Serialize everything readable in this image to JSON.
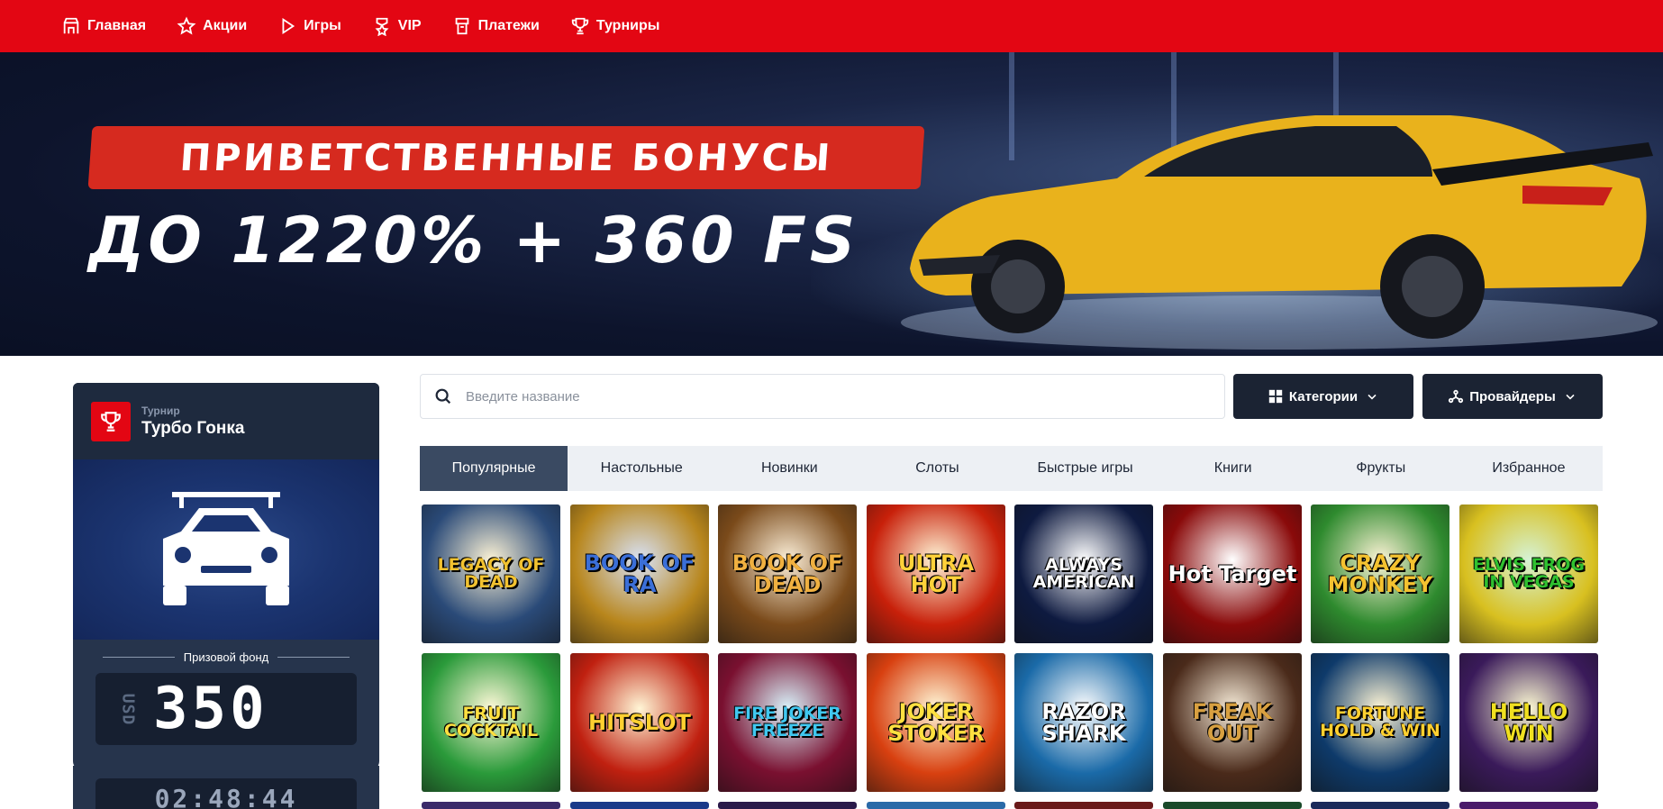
{
  "nav": {
    "items": [
      {
        "label": "Главная",
        "icon": "home-icon"
      },
      {
        "label": "Акции",
        "icon": "star-icon"
      },
      {
        "label": "Игры",
        "icon": "play-icon"
      },
      {
        "label": "VIP",
        "icon": "vip-icon"
      },
      {
        "label": "Платежи",
        "icon": "wallet-icon"
      },
      {
        "label": "Турниры",
        "icon": "trophy-icon"
      }
    ]
  },
  "banner": {
    "label": "ПРИВЕТСТВЕННЫЕ БОНУСЫ",
    "headline": "ДО 1220% + 360 FS"
  },
  "tournament": {
    "kicker": "Турнир",
    "name": "Турбо Гонка",
    "prize_label": "Призовой фонд",
    "currency": "USD",
    "amount": "350",
    "timer": "02:48:44"
  },
  "search": {
    "placeholder": "Введите название"
  },
  "filters": {
    "categories_label": "Категории",
    "providers_label": "Провайдеры"
  },
  "tabs": [
    {
      "label": "Популярные",
      "active": true
    },
    {
      "label": "Настольные",
      "active": false
    },
    {
      "label": "Новинки",
      "active": false
    },
    {
      "label": "Слоты",
      "active": false
    },
    {
      "label": "Быстрые игры",
      "active": false
    },
    {
      "label": "Книги",
      "active": false
    },
    {
      "label": "Фрукты",
      "active": false
    },
    {
      "label": "Избранное",
      "active": false
    }
  ],
  "games": [
    {
      "title": "LEGACY OF DEAD",
      "bg": "#2a4a78",
      "fg": "#f2c230"
    },
    {
      "title": "BOOK OF RA",
      "bg": "#b8861c",
      "fg": "#3b6fd8"
    },
    {
      "title": "BOOK OF DEAD",
      "bg": "#7a4a1a",
      "fg": "#f0b040"
    },
    {
      "title": "ULTRA HOT",
      "bg": "#c8200a",
      "fg": "#ffd23a"
    },
    {
      "title": "ALWAYS AMERICAN",
      "bg": "#0e1a40",
      "fg": "#ffffff"
    },
    {
      "title": "Hot Target",
      "bg": "#8a0a0a",
      "fg": "#ffffff"
    },
    {
      "title": "CRAZY MONKEY",
      "bg": "#2e8a2e",
      "fg": "#f4c230"
    },
    {
      "title": "ELVIS FROG IN VEGAS",
      "bg": "#d8c020",
      "fg": "#30c030"
    },
    {
      "title": "FRUIT COCKTAIL",
      "bg": "#2a9a3a",
      "fg": "#ffe040"
    },
    {
      "title": "HITSLOT",
      "bg": "#c02010",
      "fg": "#ffd030"
    },
    {
      "title": "FIRE JOKER FREEZE",
      "bg": "#7a1030",
      "fg": "#40c8f0"
    },
    {
      "title": "JOKER STOKER",
      "bg": "#d84010",
      "fg": "#ffe040"
    },
    {
      "title": "RAZOR SHARK",
      "bg": "#1a6aa8",
      "fg": "#ffffff"
    },
    {
      "title": "FREAK OUT",
      "bg": "#4a2a1a",
      "fg": "#d8a040"
    },
    {
      "title": "FORTUNE HOLD & WIN",
      "bg": "#0e3a6a",
      "fg": "#ffd030"
    },
    {
      "title": "HELLO WIN",
      "bg": "#3a1a5a",
      "fg": "#f0e020"
    }
  ],
  "colors": {
    "brand_red": "#e30613",
    "dark_navy": "#1b2333",
    "tab_active": "#3a4a62"
  }
}
